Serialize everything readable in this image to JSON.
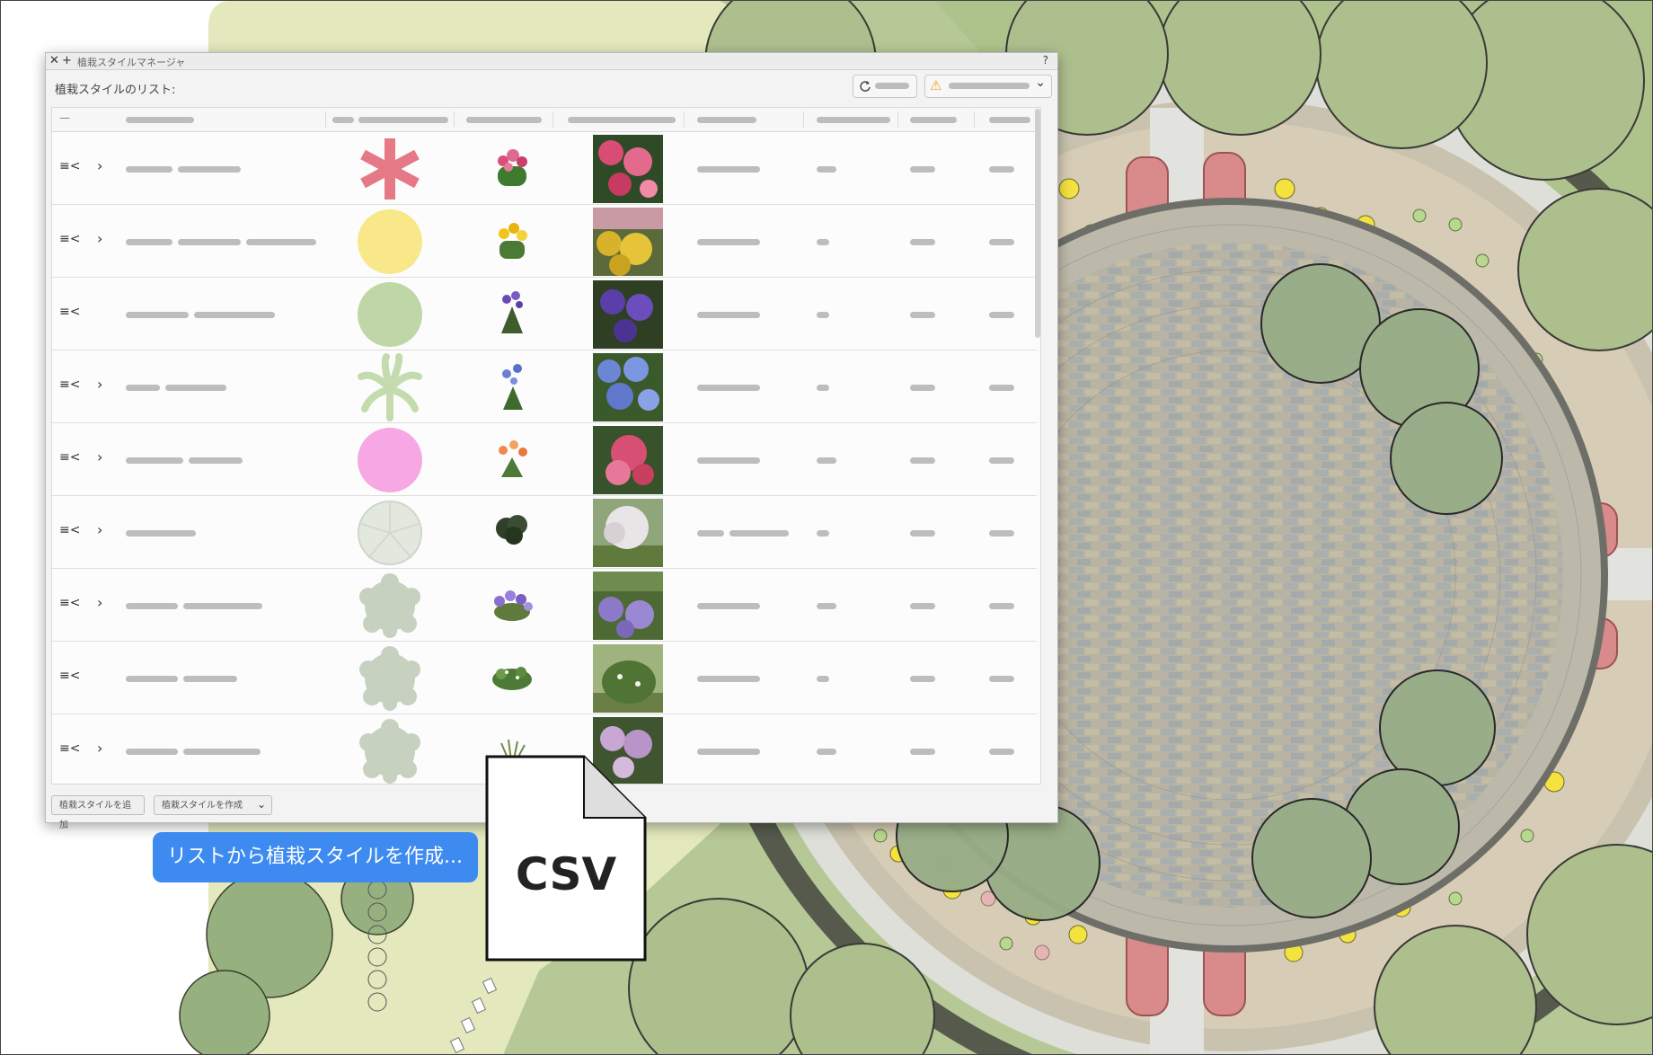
{
  "window": {
    "title": "植栽スタイルマネージャ",
    "help_label": "?",
    "close_glyph": "✕",
    "add_glyph": "+",
    "list_label": "植栽スタイルのリスト:"
  },
  "toolbar": {
    "refresh_icon": "refresh-icon",
    "warning_icon": "warning-icon",
    "warning_glyph": "⚠",
    "dropdown_glyph": "⌄"
  },
  "table": {
    "header_first": "—",
    "rows": [
      {
        "expand": "›",
        "symbol": "asterisk",
        "symbol_color": "#e57986",
        "thumb": "pink-flowers",
        "photo": "pink-red-blooms"
      },
      {
        "expand": "›",
        "symbol": "circle",
        "symbol_color": "#f8e889",
        "thumb": "yellow-flowers",
        "photo": "yellow-yarrow"
      },
      {
        "expand": "",
        "symbol": "circle",
        "symbol_color": "#bfd7a6",
        "thumb": "purple-iris",
        "photo": "purple-flowers"
      },
      {
        "expand": "›",
        "symbol": "palm",
        "symbol_color": "#c4dcad",
        "thumb": "blue-allium",
        "photo": "blue-allium"
      },
      {
        "expand": "›",
        "symbol": "circle",
        "symbol_color": "#f7a7e4",
        "thumb": "orange-lily",
        "photo": "pink-hydrangea"
      },
      {
        "expand": "›",
        "symbol": "tree-outline",
        "symbol_color": "#e3e8df",
        "thumb": "dark-shrub",
        "photo": "white-blossom-shrub"
      },
      {
        "expand": "›",
        "symbol": "cloud",
        "symbol_color": "#c7d1c0",
        "thumb": "lavender-bush",
        "photo": "lavender-field"
      },
      {
        "expand": "",
        "symbol": "cloud",
        "symbol_color": "#c7d1c0",
        "thumb": "green-shrub",
        "photo": "green-shrub"
      },
      {
        "expand": "›",
        "symbol": "cloud",
        "symbol_color": "#c7d1c0",
        "thumb": "grass",
        "photo": "lilac-shrub"
      }
    ]
  },
  "footer": {
    "add_button": "植栽スタイルを追加",
    "create_button": "植栽スタイルを作成",
    "create_caret": "⌄"
  },
  "callout": {
    "text": "リストから植栽スタイルを作成..."
  },
  "csv_file": {
    "label": "CSV"
  },
  "colors": {
    "accent_blue": "#3d8af0",
    "plan_green": "#b8cc96",
    "bed_pink": "#d98a8a",
    "paving": "#b5ab98"
  }
}
